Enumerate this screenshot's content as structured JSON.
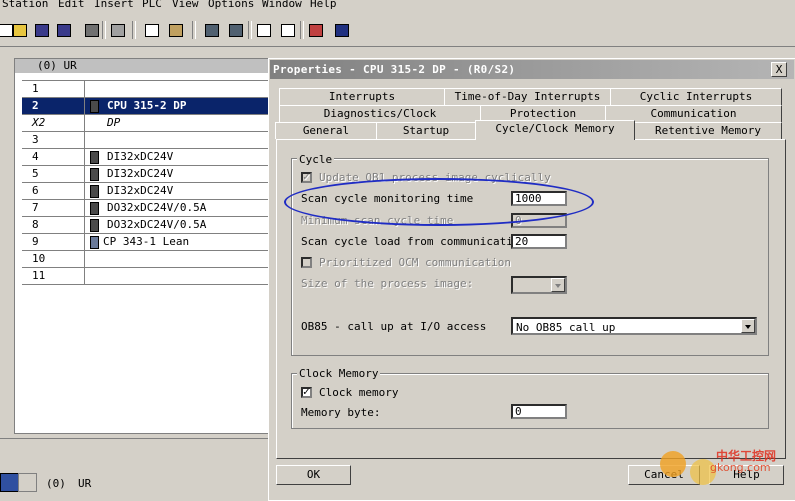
{
  "menu": [
    "Station",
    "Edit",
    "Insert",
    "PLC",
    "View",
    "Options",
    "Window",
    "Help"
  ],
  "hw_window": {
    "title": "(0) UR",
    "rack_rows": [
      {
        "slot": "1",
        "module": ""
      },
      {
        "slot": "2",
        "module": "CPU 315-2 DP",
        "selected": true
      },
      {
        "slot": "X2",
        "module": "DP",
        "italic": true
      },
      {
        "slot": "3",
        "module": ""
      },
      {
        "slot": "4",
        "module": "DI32xDC24V"
      },
      {
        "slot": "5",
        "module": "DI32xDC24V"
      },
      {
        "slot": "6",
        "module": "DI32xDC24V"
      },
      {
        "slot": "7",
        "module": "DO32xDC24V/0.5A"
      },
      {
        "slot": "8",
        "module": "DO32xDC24V/0.5A"
      },
      {
        "slot": "9",
        "module": "CP 343-1 Lean"
      },
      {
        "slot": "10",
        "module": ""
      },
      {
        "slot": "11",
        "module": ""
      }
    ]
  },
  "bottom": {
    "slot_label": "(0)",
    "rack_label": "UR"
  },
  "dialog": {
    "title": "Properties - CPU 315-2 DP - (R0/S2)",
    "close": "X",
    "tabs_row1": [
      "Interrupts",
      "Time-of-Day Interrupts",
      "Cyclic Interrupts"
    ],
    "tabs_row2": [
      "Diagnostics/Clock",
      "Protection",
      "Communication"
    ],
    "tabs_row3": [
      "General",
      "Startup",
      "Cycle/Clock Memory",
      "Retentive Memory"
    ],
    "active_tab": "Cycle/Clock Memory",
    "cycle": {
      "group_label": "Cycle",
      "update_ob1_label": "Update OB1 process image cyclically",
      "scan_monitor_label": "Scan cycle monitoring time",
      "scan_monitor_value": "1000",
      "min_scan_label": "Minimum scan cycle time",
      "min_scan_value": "0",
      "scan_load_label": "Scan cycle load from communication",
      "scan_load_value": "20",
      "prioritized_ocm_label": "Prioritized OCM communication",
      "process_image_label": "Size of the process image:",
      "process_image_value": "",
      "ob85_label": "OB85 - call up at I/O access",
      "ob85_value": "No OB85 call up"
    },
    "clock": {
      "group_label": "Clock Memory",
      "clock_memory_label": "Clock memory",
      "memory_byte_label": "Memory byte:",
      "memory_byte_value": "0"
    },
    "ok": "OK",
    "cancel": "Cancel",
    "help": "Help"
  },
  "watermark": {
    "text1": "中华工控网",
    "text2": "gkong.com"
  }
}
